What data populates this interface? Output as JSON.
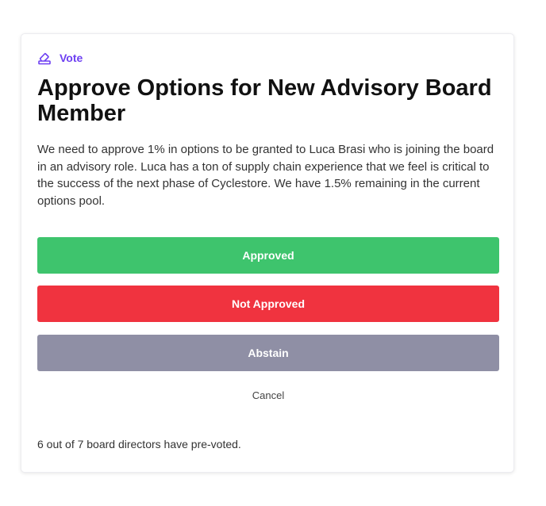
{
  "vote_tag": {
    "label": "Vote",
    "icon": "vote-box-icon",
    "color": "#6d3ff2"
  },
  "title": "Approve Options for New Advisory Board Member",
  "description": "We need to approve 1% in options to be granted to Luca Brasi who is joining the board in an advisory role. Luca has a ton of supply chain experience that we feel is critical to the success of the next phase of Cyclestore. We have 1.5% remaining in the current options pool.",
  "actions": {
    "approved": {
      "label": "Approved",
      "color": "#3ec46d"
    },
    "not_approved": {
      "label": "Not Approved",
      "color": "#f0333f"
    },
    "abstain": {
      "label": "Abstain",
      "color": "#8f8fa5"
    },
    "cancel": {
      "label": "Cancel"
    }
  },
  "footer": {
    "status": "6 out of 7 board directors have pre-voted."
  }
}
